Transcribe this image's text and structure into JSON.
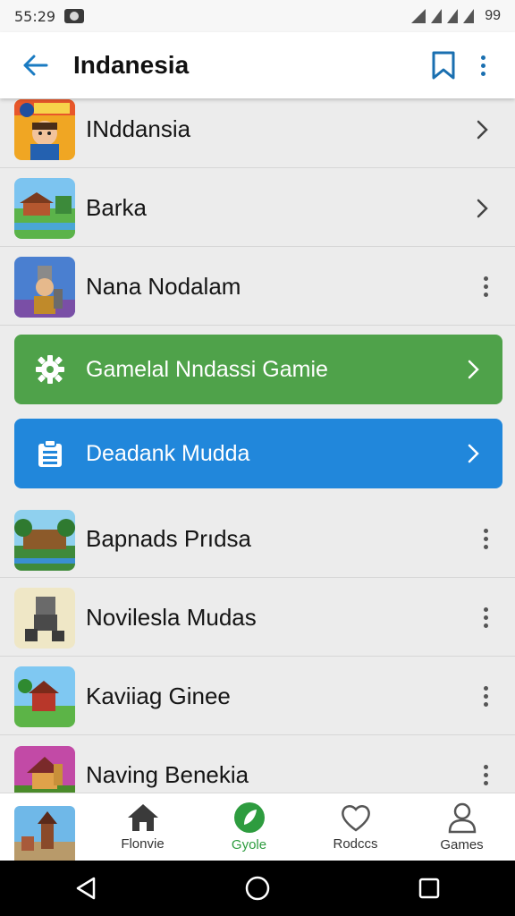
{
  "status_bar": {
    "time": "55:29",
    "battery": "99"
  },
  "app_bar": {
    "title": "Indanesia"
  },
  "list": [
    {
      "label": "INddansia",
      "action": "chevron",
      "thumb": "building-portrait"
    },
    {
      "label": "Barka",
      "action": "chevron",
      "thumb": "village-scene"
    },
    {
      "label": "Nana Nodalam",
      "action": "more",
      "thumb": "warrior-character"
    }
  ],
  "banners": [
    {
      "label": "Gamelal Nndassi Gamie",
      "color": "#4fa24a",
      "icon": "gear-icon"
    },
    {
      "label": "Deadank Mudda",
      "color": "#2187db",
      "icon": "clipboard-icon"
    }
  ],
  "list2": [
    {
      "label": "Bapnads Prıdsa",
      "action": "more",
      "thumb": "jungle-temple"
    },
    {
      "label": "Novilesla Mudas",
      "action": "more",
      "thumb": "robot-runner"
    },
    {
      "label": "Kaviiag Ginee",
      "action": "more",
      "thumb": "island-hut"
    },
    {
      "label": "Naving Benekia",
      "action": "more",
      "thumb": "pagoda-scene"
    }
  ],
  "bottom_nav": [
    {
      "label": "Flonvie",
      "icon": "home-icon"
    },
    {
      "label": "Gyole",
      "icon": "leaf-circle-icon",
      "active": true
    },
    {
      "label": "Rodccs",
      "icon": "heart-icon"
    },
    {
      "label": "Games",
      "icon": "person-icon"
    }
  ],
  "colors": {
    "accent": "#1a7bc2",
    "green": "#4fa24a",
    "blue": "#2187db",
    "nav_active": "#2e9c3f"
  }
}
